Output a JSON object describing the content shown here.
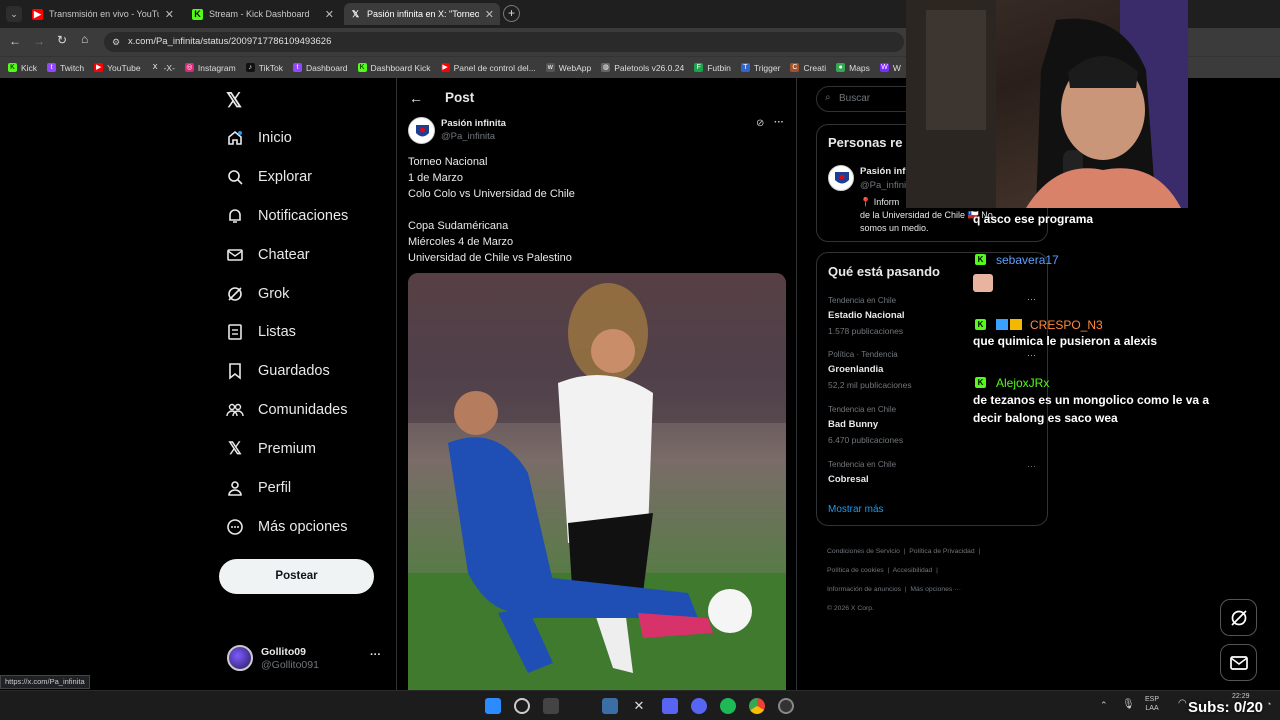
{
  "browser": {
    "tabs": [
      {
        "title": "Transmisión en vivo - YouTube",
        "close": "✕"
      },
      {
        "title": "Stream - Kick Dashboard",
        "close": "✕"
      },
      {
        "title": "Pasión infinita en X: \"Torneo N...",
        "close": "✕"
      }
    ],
    "new_tab": "+",
    "url": "x.com/Pa_infinita/status/2009717786109493626",
    "bookmarks": [
      "Kick",
      "Twitch",
      "YouTube",
      "-X-",
      "Instagram",
      "TikTok",
      "Dashboard",
      "Dashboard Kick",
      "Panel de control del...",
      "WebApp",
      "Paletools v26.0.24",
      "Futbin",
      "Trigger",
      "Creati",
      "Maps",
      "W"
    ],
    "status_url": "https://x.com/Pa_infinita"
  },
  "sidebar": {
    "items": [
      {
        "label": "Inicio",
        "icon": "home-icon"
      },
      {
        "label": "Explorar",
        "icon": "search-icon"
      },
      {
        "label": "Notificaciones",
        "icon": "bell-icon"
      },
      {
        "label": "Chatear",
        "icon": "mail-icon"
      },
      {
        "label": "Grok",
        "icon": "grok-icon"
      },
      {
        "label": "Listas",
        "icon": "list-icon"
      },
      {
        "label": "Guardados",
        "icon": "bookmark-icon"
      },
      {
        "label": "Comunidades",
        "icon": "communities-icon"
      },
      {
        "label": "Premium",
        "icon": "x-logo-icon"
      },
      {
        "label": "Perfil",
        "icon": "person-icon"
      },
      {
        "label": "Más opciones",
        "icon": "more-circle-icon"
      }
    ],
    "post_button": "Postear",
    "account": {
      "name": "Gollito09",
      "handle": "@Gollito091",
      "more": "···"
    }
  },
  "post": {
    "header": "Post",
    "author_name": "Pasión infinita",
    "author_handle": "@Pa_infinita",
    "more": "···",
    "lines": [
      "Torneo Nacional",
      "1 de Marzo",
      "Colo Colo vs Universidad de Chile",
      "",
      "Copa Sudaméricana",
      "Miércoles 4 de Marzo",
      "Universidad de Chile vs Palestino"
    ]
  },
  "right": {
    "search_placeholder": "Buscar",
    "who_to_follow_title": "Personas re",
    "who_name": "Pasión infi",
    "who_handle": "@Pa_infini",
    "who_bio_1": "📍 Inform",
    "who_bio_2": "de la Universidad de Chile 🇨🇱 No",
    "who_bio_3": "somos un medio.",
    "trends_title": "Qué está pasando",
    "trends": [
      {
        "category": "Tendencia en Chile",
        "name": "Estadio Nacional",
        "count": "1.578 publicaciones"
      },
      {
        "category": "Política · Tendencia",
        "name": "Groenlandia",
        "count": "52,2 mil publicaciones"
      },
      {
        "category": "Tendencia en Chile",
        "name": "Bad Bunny",
        "count": "6.470 publicaciones"
      },
      {
        "category": "Tendencia en Chile",
        "name": "Cobresal",
        "count": ""
      }
    ],
    "show_more": "Mostrar más",
    "footer": [
      "Condiciones de Servicio",
      "Política de Privacidad",
      "Política de cookies",
      "Accesibilidad",
      "Información de anuncios",
      "Más opciones ···",
      "© 2026 X Corp."
    ]
  },
  "chat": {
    "messages": [
      {
        "user": "",
        "text": "q asco ese programa",
        "color": "#ffffff"
      },
      {
        "user": "sebavera17",
        "text": "",
        "color": "#5aa0ff"
      },
      {
        "user": "CRESPO_N3",
        "text": "que quimica le pusieron a alexis",
        "color": "#ff8a3d"
      },
      {
        "user": "AlejoxJRx",
        "text": "de tezanos es un mongolico como le va a decir balong es saco wea",
        "color": "#53fc18"
      }
    ],
    "subs": "Subs: 0/20"
  },
  "taskbar": {
    "lang_1": "ESP",
    "lang_2": "LAA",
    "time": "22:29"
  },
  "colors": {
    "kick_green": "#53fc18",
    "x_bg": "#000000",
    "link_blue": "#1d9bf0"
  }
}
